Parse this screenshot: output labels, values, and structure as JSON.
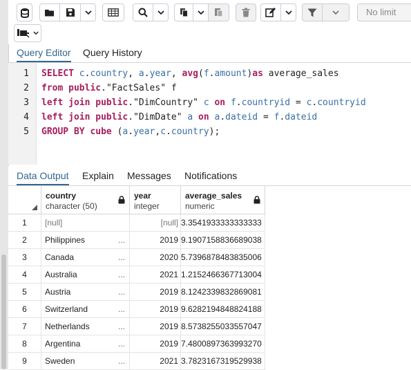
{
  "toolbar": {
    "limit_label": "No limit",
    "icons": [
      "database-icon",
      "open-folder-icon",
      "save-icon",
      "chevron-down-icon",
      "grid-icon",
      "search-icon",
      "chevron-down-icon",
      "copy-icon",
      "chevron-down-icon",
      "paste-icon",
      "trash-icon",
      "edit-icon",
      "chevron-down-icon",
      "filter-icon",
      "chevron-down-icon",
      "commit-icon",
      "chevron-down-icon"
    ]
  },
  "editor_tabs": {
    "query_editor": "Query Editor",
    "query_history": "Query History"
  },
  "sql_lines": [
    {
      "num": "1",
      "tokens": [
        [
          "kw",
          "SELECT"
        ],
        [
          "pn",
          " "
        ],
        [
          "id",
          "c"
        ],
        [
          "pn",
          "."
        ],
        [
          "id",
          "country"
        ],
        [
          "pn",
          ", "
        ],
        [
          "id",
          "a"
        ],
        [
          "pn",
          "."
        ],
        [
          "id",
          "year"
        ],
        [
          "pn",
          ", "
        ],
        [
          "kw",
          "avg"
        ],
        [
          "pn",
          "("
        ],
        [
          "id",
          "f"
        ],
        [
          "pn",
          "."
        ],
        [
          "id",
          "amount"
        ],
        [
          "pn",
          ")"
        ],
        [
          "kw",
          "as"
        ],
        [
          "pn",
          " average_sales"
        ]
      ]
    },
    {
      "num": "2",
      "tokens": [
        [
          "kw",
          "from"
        ],
        [
          "pn",
          " "
        ],
        [
          "kw",
          "public"
        ],
        [
          "pn",
          "."
        ],
        [
          "str",
          "\"FactSales\""
        ],
        [
          "pn",
          " f"
        ]
      ]
    },
    {
      "num": "3",
      "tokens": [
        [
          "kw",
          "left join"
        ],
        [
          "pn",
          " "
        ],
        [
          "kw",
          "public"
        ],
        [
          "pn",
          "."
        ],
        [
          "str",
          "\"DimCountry\""
        ],
        [
          "pn",
          " "
        ],
        [
          "id",
          "c"
        ],
        [
          "pn",
          " "
        ],
        [
          "kw",
          "on"
        ],
        [
          "pn",
          " "
        ],
        [
          "id",
          "f"
        ],
        [
          "pn",
          "."
        ],
        [
          "id",
          "countryid"
        ],
        [
          "pn",
          " = "
        ],
        [
          "id",
          "c"
        ],
        [
          "pn",
          "."
        ],
        [
          "id",
          "countryid"
        ]
      ]
    },
    {
      "num": "4",
      "tokens": [
        [
          "kw",
          "left join"
        ],
        [
          "pn",
          " "
        ],
        [
          "kw",
          "public"
        ],
        [
          "pn",
          "."
        ],
        [
          "str",
          "\"DimDate\""
        ],
        [
          "pn",
          " "
        ],
        [
          "id",
          "a"
        ],
        [
          "pn",
          " "
        ],
        [
          "kw",
          "on"
        ],
        [
          "pn",
          " "
        ],
        [
          "id",
          "a"
        ],
        [
          "pn",
          "."
        ],
        [
          "id",
          "dateid"
        ],
        [
          "pn",
          " = "
        ],
        [
          "id",
          "f"
        ],
        [
          "pn",
          "."
        ],
        [
          "id",
          "dateid"
        ]
      ]
    },
    {
      "num": "5",
      "tokens": [
        [
          "kw",
          "GROUP BY"
        ],
        [
          "pn",
          " "
        ],
        [
          "kw",
          "cube"
        ],
        [
          "pn",
          " ("
        ],
        [
          "id",
          "a"
        ],
        [
          "pn",
          "."
        ],
        [
          "id",
          "year"
        ],
        [
          "pn",
          ","
        ],
        [
          "id",
          "c"
        ],
        [
          "pn",
          "."
        ],
        [
          "id",
          "country"
        ],
        [
          "pn",
          ");"
        ]
      ]
    }
  ],
  "output_tabs": {
    "data_output": "Data Output",
    "explain": "Explain",
    "messages": "Messages",
    "notifications": "Notifications"
  },
  "columns": [
    {
      "name": "country",
      "type": "character (50)"
    },
    {
      "name": "year",
      "type": "integer"
    },
    {
      "name": "average_sales",
      "type": "numeric"
    }
  ],
  "rows": [
    {
      "n": "1",
      "country": "[null]",
      "year": "[null]",
      "avg": "3.3541933333333333",
      "dots": false
    },
    {
      "n": "2",
      "country": "Philippines",
      "year": "2019",
      "avg": "9.1907158836689038",
      "dots": true
    },
    {
      "n": "3",
      "country": "Canada",
      "year": "2020",
      "avg": "5.7396878483835006",
      "dots": true
    },
    {
      "n": "4",
      "country": "Australia",
      "year": "2021",
      "avg": "1.2152466367713004",
      "dots": true
    },
    {
      "n": "5",
      "country": "Austria",
      "year": "2019",
      "avg": "8.1242339832869081",
      "dots": true
    },
    {
      "n": "6",
      "country": "Switzerland",
      "year": "2019",
      "avg": "9.6282194848824188",
      "dots": true
    },
    {
      "n": "7",
      "country": "Netherlands",
      "year": "2019",
      "avg": "8.5738255033557047",
      "dots": true
    },
    {
      "n": "8",
      "country": "Argentina",
      "year": "2019",
      "avg": "7.4800897363993270",
      "dots": true
    },
    {
      "n": "9",
      "country": "Sweden",
      "year": "2021",
      "avg": "3.7823167319529938",
      "dots": true
    }
  ],
  "ellipsis": "..."
}
